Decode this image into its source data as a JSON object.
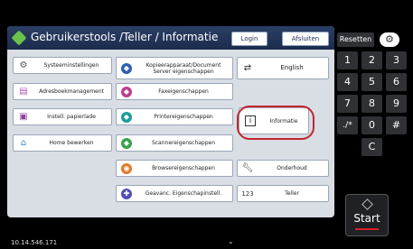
{
  "header": {
    "title": "Gebruikerstools /Teller / Informatie",
    "login_label": "Login",
    "logout_label": "Afsluiten"
  },
  "tiles": {
    "systeem": "Systeeminstellingen",
    "adresboek": "Adresboekmanagement",
    "papierlade": "Instell. papierlade",
    "home": "Home bewerken",
    "kopieer": "Kopieerapparaat/Document Server eigenschappen",
    "fax": "Faxeigenschappen",
    "printer": "Printereigenschappen",
    "scanner": "Scannereigenschappen",
    "browser": "Browsereigenschappen",
    "geavanc": "Geavanc. Eigenschapinstell.",
    "english": "English",
    "informatie": "Informatie",
    "onderhoud": "Onderhoud",
    "teller": "Teller"
  },
  "side": {
    "reset_label": "Resetten",
    "keys": [
      "1",
      "2",
      "3",
      "4",
      "5",
      "6",
      "7",
      "8",
      "9",
      "./*",
      "0",
      "#",
      "C"
    ],
    "start_label": "Start"
  },
  "footer": {
    "ip": "10.14.546.171"
  },
  "colors": {
    "header_bg": "#1b2c4b",
    "accent_green": "#6bc24a",
    "highlight_red": "#c0262e",
    "start_underline": "#d8202a"
  }
}
